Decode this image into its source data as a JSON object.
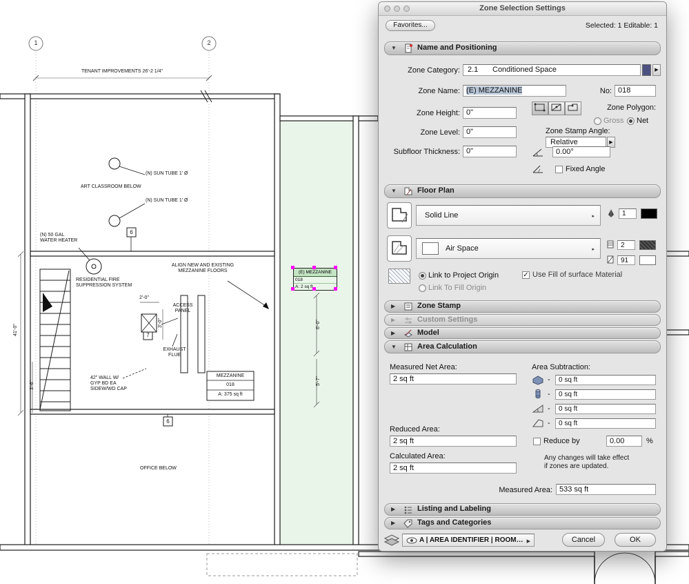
{
  "window": {
    "title": "Zone Selection Settings"
  },
  "toolbar": {
    "favorites": "Favorites...",
    "status": "Selected: 1 Editable: 1"
  },
  "colors": {
    "zone_fill": "#e9f5e9",
    "category_swatch": "#4c5180",
    "selection_handle": "#ff00ff"
  },
  "name_positioning": {
    "header": "Name and Positioning",
    "zone_category_label": "Zone Category:",
    "zone_category_code": "2.1",
    "zone_category_name": "Conditioned Space",
    "zone_name_label": "Zone Name:",
    "zone_name": "(E) MEZZANINE",
    "no_label": "No:",
    "no_value": "018",
    "zone_height_label": "Zone Height:",
    "zone_height": "0\"",
    "zone_level_label": "Zone Level:",
    "zone_level": "0\"",
    "subfloor_label": "Subfloor Thickness:",
    "subfloor": "0\"",
    "zone_polygon_label": "Zone Polygon:",
    "gross": "Gross",
    "net": "Net",
    "stamp_angle_label": "Zone Stamp Angle:",
    "relative": "Relative",
    "angle": "0.00°",
    "fixed_angle": "Fixed Angle"
  },
  "floor_plan": {
    "header": "Floor Plan",
    "contour_style": "Solid Line",
    "contour_pen": "1",
    "fill_name": "Air Space",
    "fill_pen": "2",
    "fill_bg_pen": "91",
    "link_project": "Link to Project Origin",
    "link_fill": "Link To Fill Origin",
    "use_fill_surface": "Use Fill of surface Material"
  },
  "sections": {
    "zone_stamp": "Zone Stamp",
    "custom_settings": "Custom Settings",
    "model": "Model",
    "area_calculation": "Area Calculation",
    "listing": "Listing and Labeling",
    "tags": "Tags and Categories"
  },
  "area_calc": {
    "measured_net_label": "Measured Net Area:",
    "measured_net": "2 sq ft",
    "subtraction_label": "Area Subtraction:",
    "minus": "-",
    "sub_values": [
      "0 sq ft",
      "0 sq ft",
      "0 sq ft",
      "0 sq ft"
    ],
    "reduced_label": "Reduced Area:",
    "reduced": "2 sq ft",
    "reduce_by": "Reduce by",
    "reduce_value": "0.00",
    "percent": "%",
    "calculated_label": "Calculated Area:",
    "calculated": "2 sq ft",
    "note": "Any changes will take effect\nif zones are updated.",
    "measured_label": "Measured Area:",
    "measured": "533 sq ft"
  },
  "footer": {
    "layer_combo": "A | AREA IDENTIFIER | ROOM…",
    "cancel": "Cancel",
    "ok": "OK"
  },
  "plan": {
    "grid1": "1",
    "grid2": "2",
    "tenant_dim": "TENANT IMPROVEMENTS 26'-2 1/4\"",
    "sun_tube_1": "(N) SUN TUBE 1' Ø",
    "art_classroom": "ART CLASSROOM BELOW",
    "sun_tube_2": "(N) SUN TUBE 1' Ø",
    "water_heater": "(N) 50 GAL\nWATER HEATER",
    "marker_6": "6",
    "marker_7": "7",
    "fire_suppression": "RESIDENTIAL FIRE\nSUPPRESSION SYSTEM",
    "align_mezz": "ALIGN NEW AND EXISTING\nMEZZANINE FLOORS",
    "access_panel": "ACCESS\nPANEL",
    "exhaust_flue": "EXHAUST\nFLUE",
    "wall_note": "42\" WALL W/\nGYP BD EA\nSIDEW/WD CAP",
    "mezz_label": {
      "title": "MEZZANINE",
      "no": "018",
      "area": "A: 375 sq ft"
    },
    "office_below": "OFFICE BELOW",
    "dims": {
      "d20": "2'-0\"",
      "d30": "3'-0\"",
      "d410": "41'-0\"",
      "d36": "3'-6\"",
      "d60": "6'-0\"",
      "d57": "5'-7\""
    },
    "zone_stamp": {
      "name": "(E) MEZZANINE",
      "no": "018",
      "area": "A: 2 sq ft"
    }
  }
}
